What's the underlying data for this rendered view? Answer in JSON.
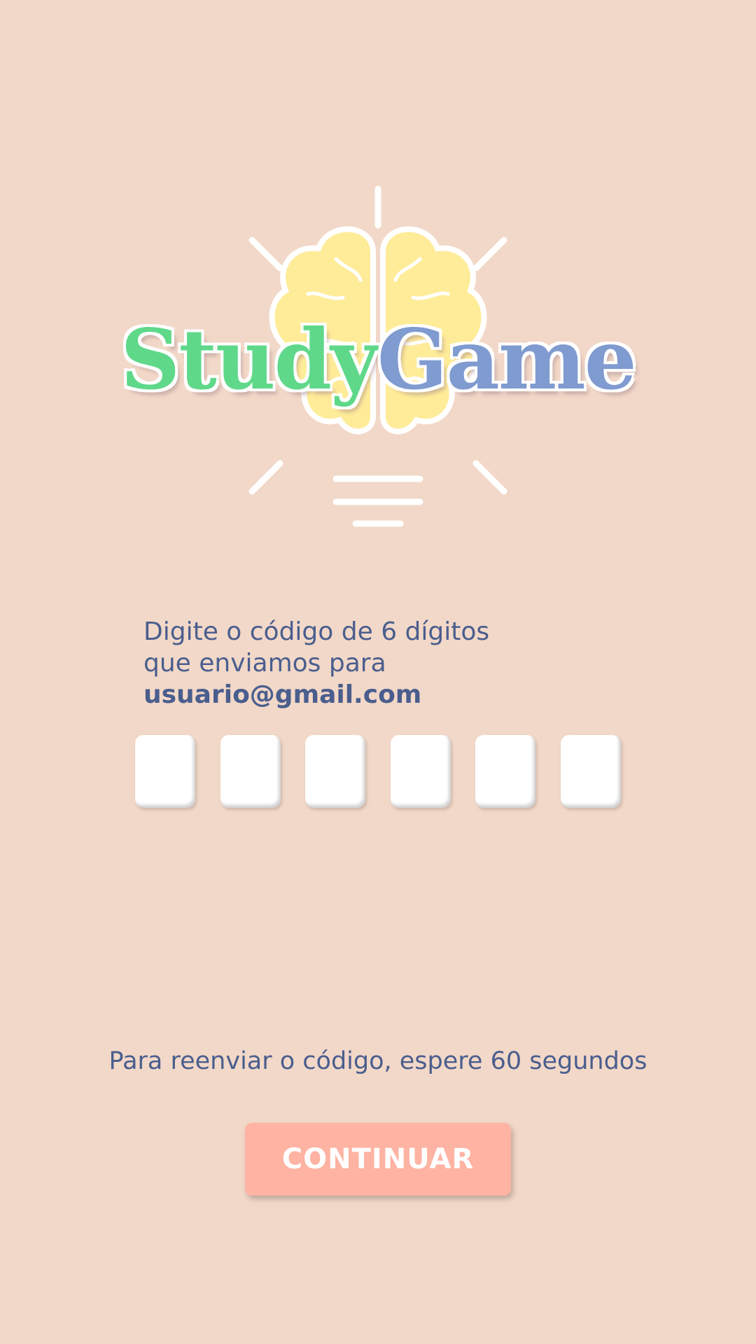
{
  "app": {
    "logo_text_part1": "Study",
    "logo_text_part2": "Game"
  },
  "verification": {
    "line1": "Digite o código de 6 dígitos",
    "line2": "que enviamos para",
    "email": "usuario@gmail.com",
    "code_digits": [
      "",
      "",
      "",
      "",
      "",
      ""
    ]
  },
  "resend": {
    "text": "Para reenviar o código, espere 60 segundos"
  },
  "actions": {
    "continue_label": "CONTINUAR"
  },
  "colors": {
    "background": "#f2d8c8",
    "text": "#4a5e8e",
    "button": "#ffb3a3",
    "logo_study": "#5fd88a",
    "logo_game": "#7f9bd0",
    "brain": "#ffec99"
  },
  "icons": {
    "logo_icon": "brain-lightbulb-icon"
  }
}
